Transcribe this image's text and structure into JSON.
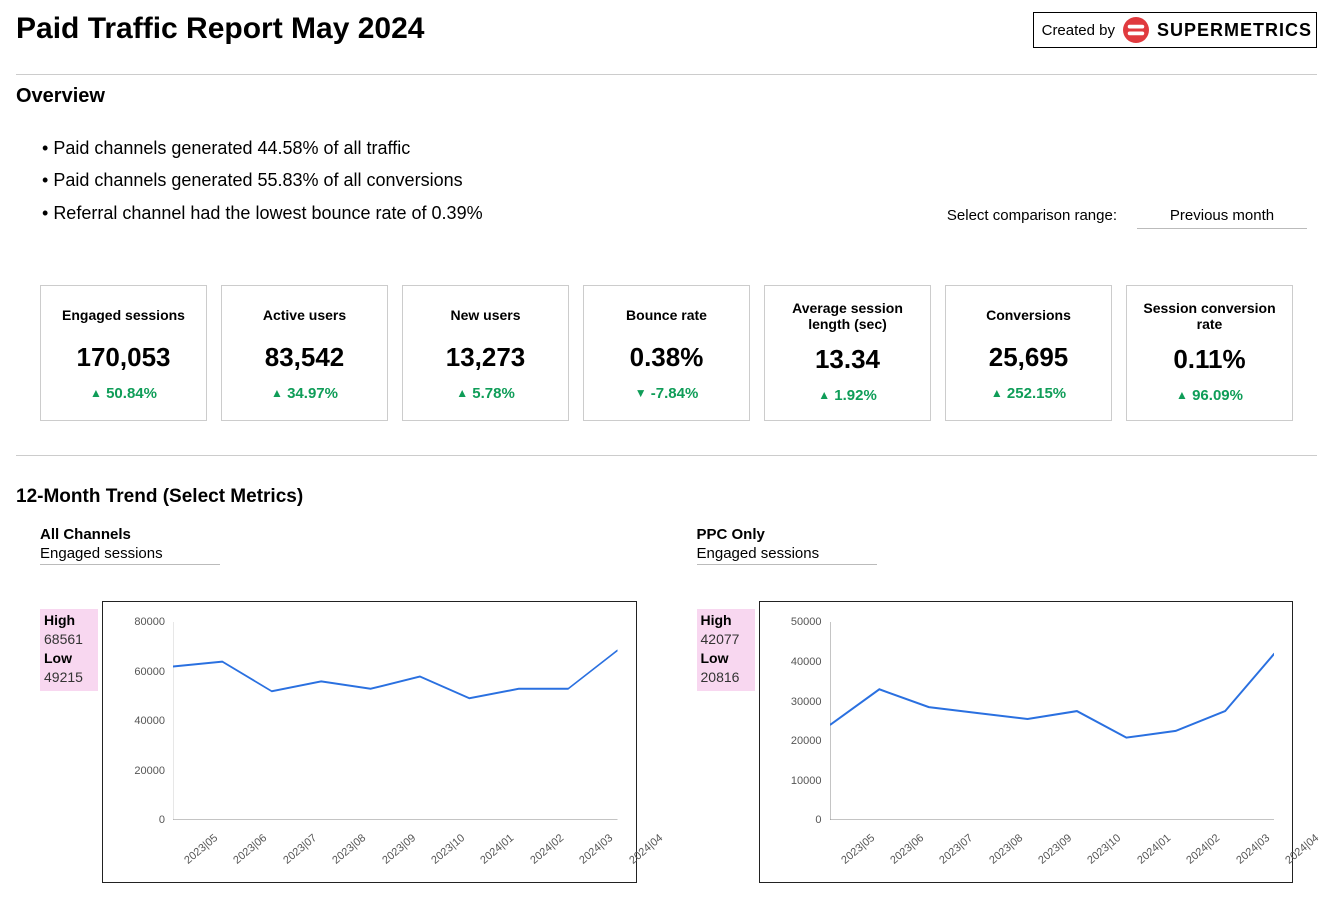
{
  "header": {
    "title": "Paid Traffic Report May 2024",
    "created_by_label": "Created by",
    "brand": "SUPERMETRICS"
  },
  "overview": {
    "title": "Overview",
    "bullets": [
      "Paid channels generated 44.58% of all traffic",
      "Paid channels generated 55.83% of all conversions",
      "Referral channel had the lowest bounce rate of 0.39%"
    ],
    "comparison_label": "Select comparison range:",
    "comparison_value": "Previous month"
  },
  "kpis": [
    {
      "label": "Engaged sessions",
      "value": "170,053",
      "delta": "50.84%",
      "dir": "up"
    },
    {
      "label": "Active users",
      "value": "83,542",
      "delta": "34.97%",
      "dir": "up"
    },
    {
      "label": "New users",
      "value": "13,273",
      "delta": "5.78%",
      "dir": "up"
    },
    {
      "label": "Bounce rate",
      "value": "0.38%",
      "delta": "-7.84%",
      "dir": "down"
    },
    {
      "label": "Average session length (sec)",
      "value": "13.34",
      "delta": "1.92%",
      "dir": "up"
    },
    {
      "label": "Conversions",
      "value": "25,695",
      "delta": "252.15%",
      "dir": "up"
    },
    {
      "label": "Session conversion rate",
      "value": "0.11%",
      "delta": "96.09%",
      "dir": "up"
    }
  ],
  "trend": {
    "title": "12-Month Trend (Select Metrics)",
    "charts": [
      {
        "channel": "All Channels",
        "metric": "Engaged sessions",
        "high_label": "High",
        "high": "68561",
        "low_label": "Low",
        "low": "49215"
      },
      {
        "channel": "PPC Only",
        "metric": "Engaged sessions",
        "high_label": "High",
        "high": "42077",
        "low_label": "Low",
        "low": "20816"
      }
    ]
  },
  "chart_data": [
    {
      "type": "line",
      "title": "All Channels — Engaged sessions",
      "xlabel": "",
      "ylabel": "",
      "ylim": [
        0,
        80000
      ],
      "y_ticks": [
        0,
        20000,
        40000,
        60000,
        80000
      ],
      "categories": [
        "2023|05",
        "2023|06",
        "2023|07",
        "2023|08",
        "2023|09",
        "2023|10",
        "2024|01",
        "2024|02",
        "2024|03",
        "2024|04"
      ],
      "values": [
        62000,
        64000,
        52000,
        56000,
        53000,
        58000,
        49215,
        53000,
        53000,
        68561
      ]
    },
    {
      "type": "line",
      "title": "PPC Only — Engaged sessions",
      "xlabel": "",
      "ylabel": "",
      "ylim": [
        0,
        50000
      ],
      "y_ticks": [
        0,
        10000,
        20000,
        30000,
        40000,
        50000
      ],
      "categories": [
        "2023|05",
        "2023|06",
        "2023|07",
        "2023|08",
        "2023|09",
        "2023|10",
        "2024|01",
        "2024|02",
        "2024|03",
        "2024|04"
      ],
      "values": [
        24000,
        33000,
        28500,
        27000,
        25500,
        27500,
        20816,
        22500,
        27500,
        42077
      ]
    }
  ]
}
